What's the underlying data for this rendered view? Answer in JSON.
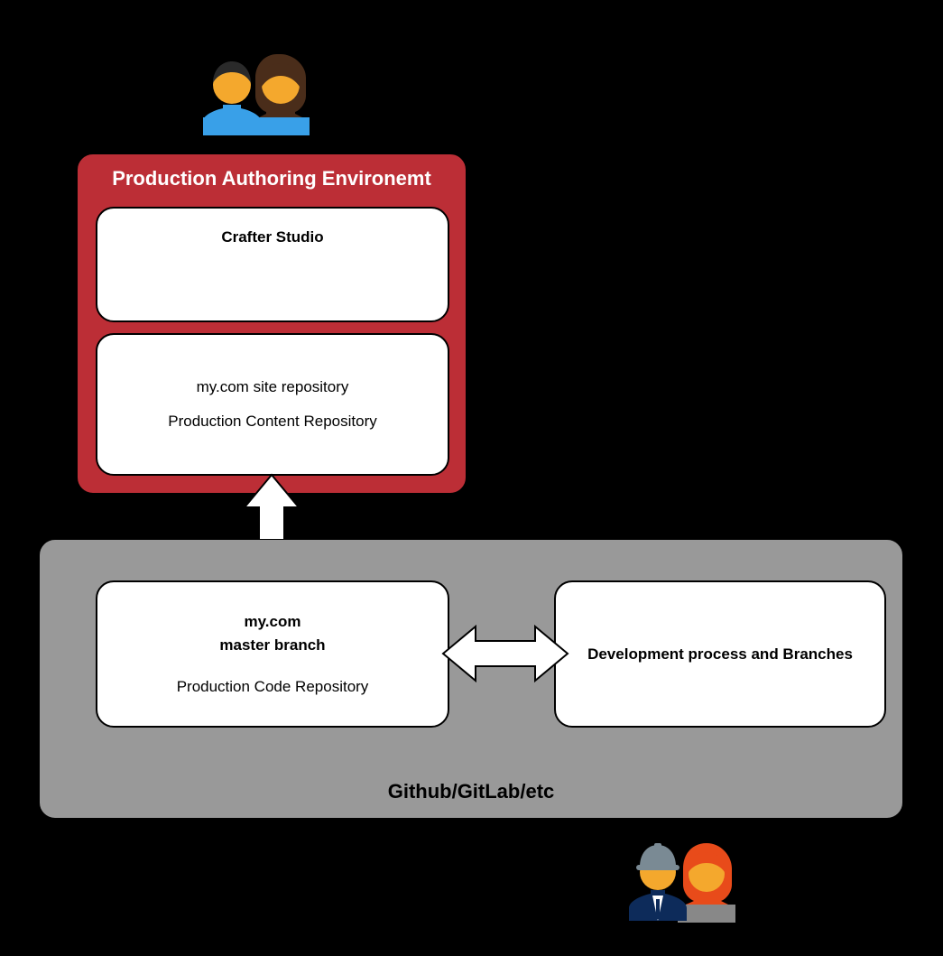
{
  "diagram": {
    "prodEnv": {
      "title": "Production Authoring Environemt",
      "studio": "Crafter Studio",
      "repoLine1": "my.com site repository",
      "repoLine2": "Production Content Repository"
    },
    "gitContainer": {
      "title": "Github/GitLab/etc",
      "master": {
        "line1": "my.com",
        "line2": "master branch",
        "line3": "Production Code Repository"
      },
      "dev": "Development process and Branches"
    },
    "icons": {
      "topPeople": "content-authors-icon",
      "bottomPeople": "developers-icon",
      "verticalArrow": "bidirectional-vertical-arrow",
      "horizontalArrow": "bidirectional-horizontal-arrow"
    }
  }
}
